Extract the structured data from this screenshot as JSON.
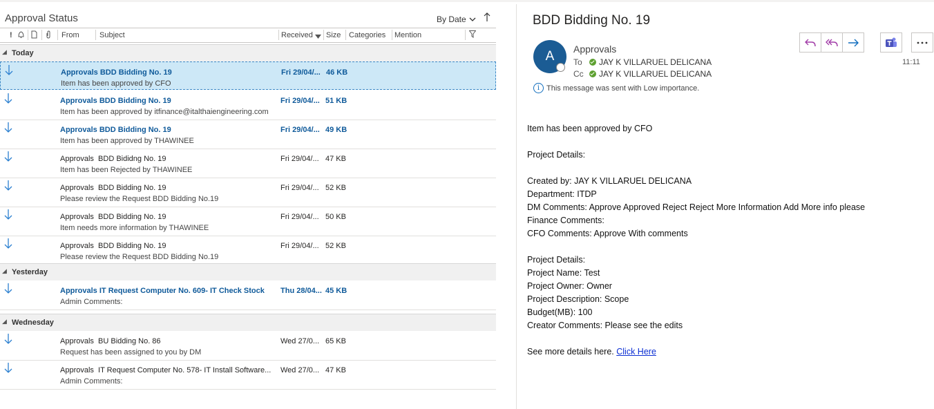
{
  "list": {
    "folder_title": "Approval Status",
    "sort_label": "By Date",
    "columns": {
      "from": "From",
      "subject": "Subject",
      "received": "Received",
      "size": "Size",
      "categories": "Categories",
      "mention": "Mention"
    },
    "groups": [
      {
        "label": "Today",
        "rows": [
          {
            "from": "Approvals",
            "subject": "BDD Bidding No. 19",
            "preview": "Item has been approved by CFO",
            "received": "Fri 29/04/...",
            "size": "46 KB",
            "unread": true,
            "selected": true
          },
          {
            "from": "Approvals",
            "subject": "BDD Bidding No. 19",
            "preview": "Item has been approved by itfinance@italthaiengineering.com",
            "received": "Fri 29/04/...",
            "size": "51 KB",
            "unread": true,
            "selected": false
          },
          {
            "from": "Approvals",
            "subject": "BDD Bidding No. 19",
            "preview": "Item has been approved by THAWINEE",
            "received": "Fri 29/04/...",
            "size": "49 KB",
            "unread": true,
            "selected": false
          },
          {
            "from": "Approvals",
            "subject": " BDD Bididng No. 19",
            "preview": "Item has been Rejected by THAWINEE",
            "received": "Fri 29/04/...",
            "size": "47 KB",
            "unread": false,
            "selected": false
          },
          {
            "from": "Approvals",
            "subject": " BDD Bidding No. 19",
            "preview": "Please review the Request BDD Bidding No.19",
            "received": "Fri 29/04/...",
            "size": "52 KB",
            "unread": false,
            "selected": false
          },
          {
            "from": "Approvals",
            "subject": " BDD Bidding No. 19",
            "preview": "Item needs more information by THAWINEE",
            "received": "Fri 29/04/...",
            "size": "50 KB",
            "unread": false,
            "selected": false
          },
          {
            "from": "Approvals",
            "subject": " BDD Bidding No. 19",
            "preview": "Please review the Request BDD Bidding No.19",
            "received": "Fri 29/04/...",
            "size": "52 KB",
            "unread": false,
            "selected": false
          }
        ]
      },
      {
        "label": "Yesterday",
        "rows": [
          {
            "from": "Approvals",
            "subject": "IT Request Computer No. 609- IT Check Stock",
            "preview": "Admin Comments:",
            "received": "Thu 28/04...",
            "size": "45 KB",
            "unread": true,
            "selected": false
          }
        ]
      },
      {
        "label": "Wednesday",
        "rows": [
          {
            "from": "Approvals",
            "subject": " BU Bidding No. 86",
            "preview": "Request has been assigned to you by DM",
            "received": "Wed 27/0...",
            "size": "65 KB",
            "unread": false,
            "selected": false
          },
          {
            "from": "Approvals",
            "subject": " IT Request Computer No. 578- IT Install Software...",
            "preview": "Admin Comments:",
            "received": "Wed 27/0...",
            "size": "47 KB",
            "unread": false,
            "selected": false
          }
        ]
      }
    ]
  },
  "reading": {
    "title": "BDD Bidding No. 19",
    "avatar_letter": "A",
    "sender": "Approvals",
    "to_label": "To",
    "to_name": "JAY K VILLARUEL DELICANA",
    "cc_label": "Cc",
    "cc_name": "JAY K VILLARUEL DELICANA",
    "importance_note": "This message was sent with Low importance.",
    "time": "11:11",
    "body": {
      "line_approved": "Item has been approved by CFO",
      "project_details_1": "Project Details:",
      "created_by": "Created by: JAY K VILLARUEL DELICANA",
      "department": "Department: ITDP",
      "dm_comments": "DM Comments: Approve Approved Reject Reject More Information Add More info please",
      "finance_comments": "Finance Comments:",
      "cfo_comments": "CFO Comments: Approve With comments",
      "project_details_2": "Project Details:",
      "project_name": "Project Name: Test",
      "project_owner": "Project Owner: Owner",
      "project_description": "Project Description: Scope",
      "budget": "Budget(MB): 100",
      "creator_comments": "Creator Comments: Please see the edits",
      "see_more": "See more details here. ",
      "link_text": "Click Here"
    }
  },
  "colors": {
    "unread_text": "#0f5a9a",
    "selected_bg": "#cde8f7",
    "avatar_bg": "#1b5c94",
    "link": "#0b2ed3",
    "reply_icon": "#a23da8",
    "forward_icon": "#0f6cbd",
    "teams_icon": "#4b53bc"
  }
}
